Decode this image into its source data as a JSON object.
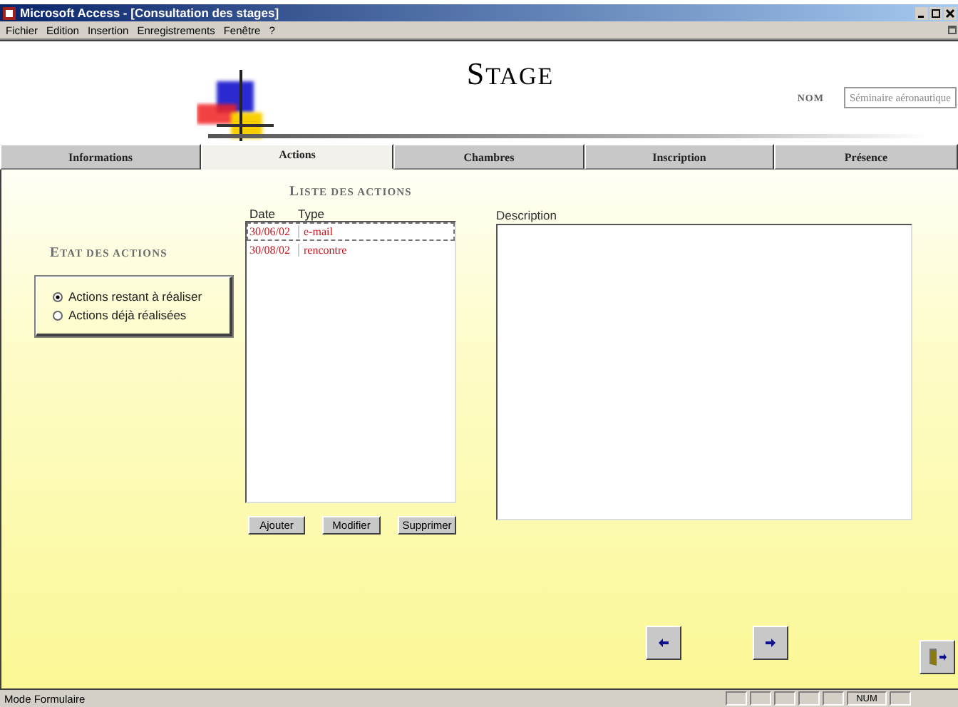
{
  "window": {
    "title": "Microsoft Access - [Consultation des stages]"
  },
  "menu": [
    "Fichier",
    "Edition",
    "Insertion",
    "Enregistrements",
    "Fenêtre",
    "?"
  ],
  "header": {
    "title": "STAGE",
    "name_label": "NOM",
    "name_value": "Séminaire aéronautique"
  },
  "tabs": [
    {
      "label": "Informations",
      "selected": false
    },
    {
      "label": "Actions",
      "selected": true
    },
    {
      "label": "Chambres",
      "selected": false
    },
    {
      "label": "Inscription",
      "selected": false
    },
    {
      "label": "Présence",
      "selected": false
    }
  ],
  "state_group": {
    "title": "ETAT DES ACTIONS",
    "options": [
      {
        "label": "Actions restant à réaliser",
        "selected": true
      },
      {
        "label": "Actions déjà réalisées",
        "selected": false
      }
    ]
  },
  "actions_list": {
    "title": "LISTE DES ACTIONS",
    "columns": [
      "Date",
      "Type"
    ],
    "rows": [
      {
        "date": "30/06/02",
        "type": "e-mail",
        "selected": true
      },
      {
        "date": "30/08/02",
        "type": "rencontre",
        "selected": false
      }
    ]
  },
  "buttons": [
    "Ajouter",
    "Modifier",
    "Supprimer"
  ],
  "description": {
    "label": "Description"
  },
  "status_bar": {
    "mode": "Mode Formulaire",
    "indicator": "NUM"
  }
}
